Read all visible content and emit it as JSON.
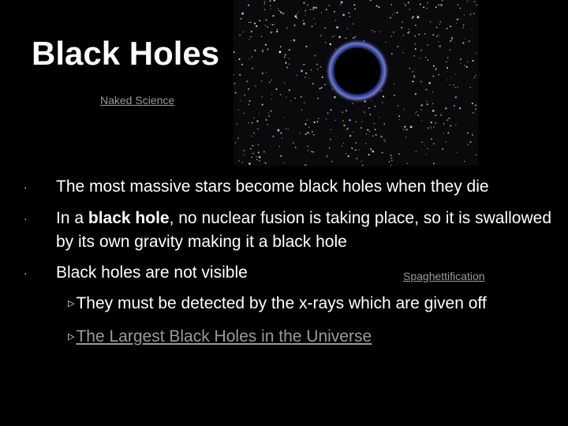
{
  "slide": {
    "title": "Black Holes",
    "naked_science_link": "Naked Science",
    "image_label": "black-hole-starfield",
    "bullets": [
      {
        "text": "The most massive stars become black holes when they die"
      },
      {
        "text_before": "In a ",
        "bold": "black hole",
        "text_after": ", no nuclear fusion is taking place, so it is swallowed by its own gravity making it a black hole"
      },
      {
        "text": "Black holes are not visible"
      }
    ],
    "bullet_marker": "·",
    "spaghettification_link": "Spaghettification",
    "sub_bullets": [
      {
        "text": "They must be detected by the x-rays which are given off"
      },
      {
        "text": "The Largest Black Holes in the Universe",
        "is_link": true
      }
    ],
    "sub_marker": "▷",
    "colors": {
      "background": "#000000",
      "text": "#ffffff",
      "link": "#9a9a9a"
    }
  }
}
